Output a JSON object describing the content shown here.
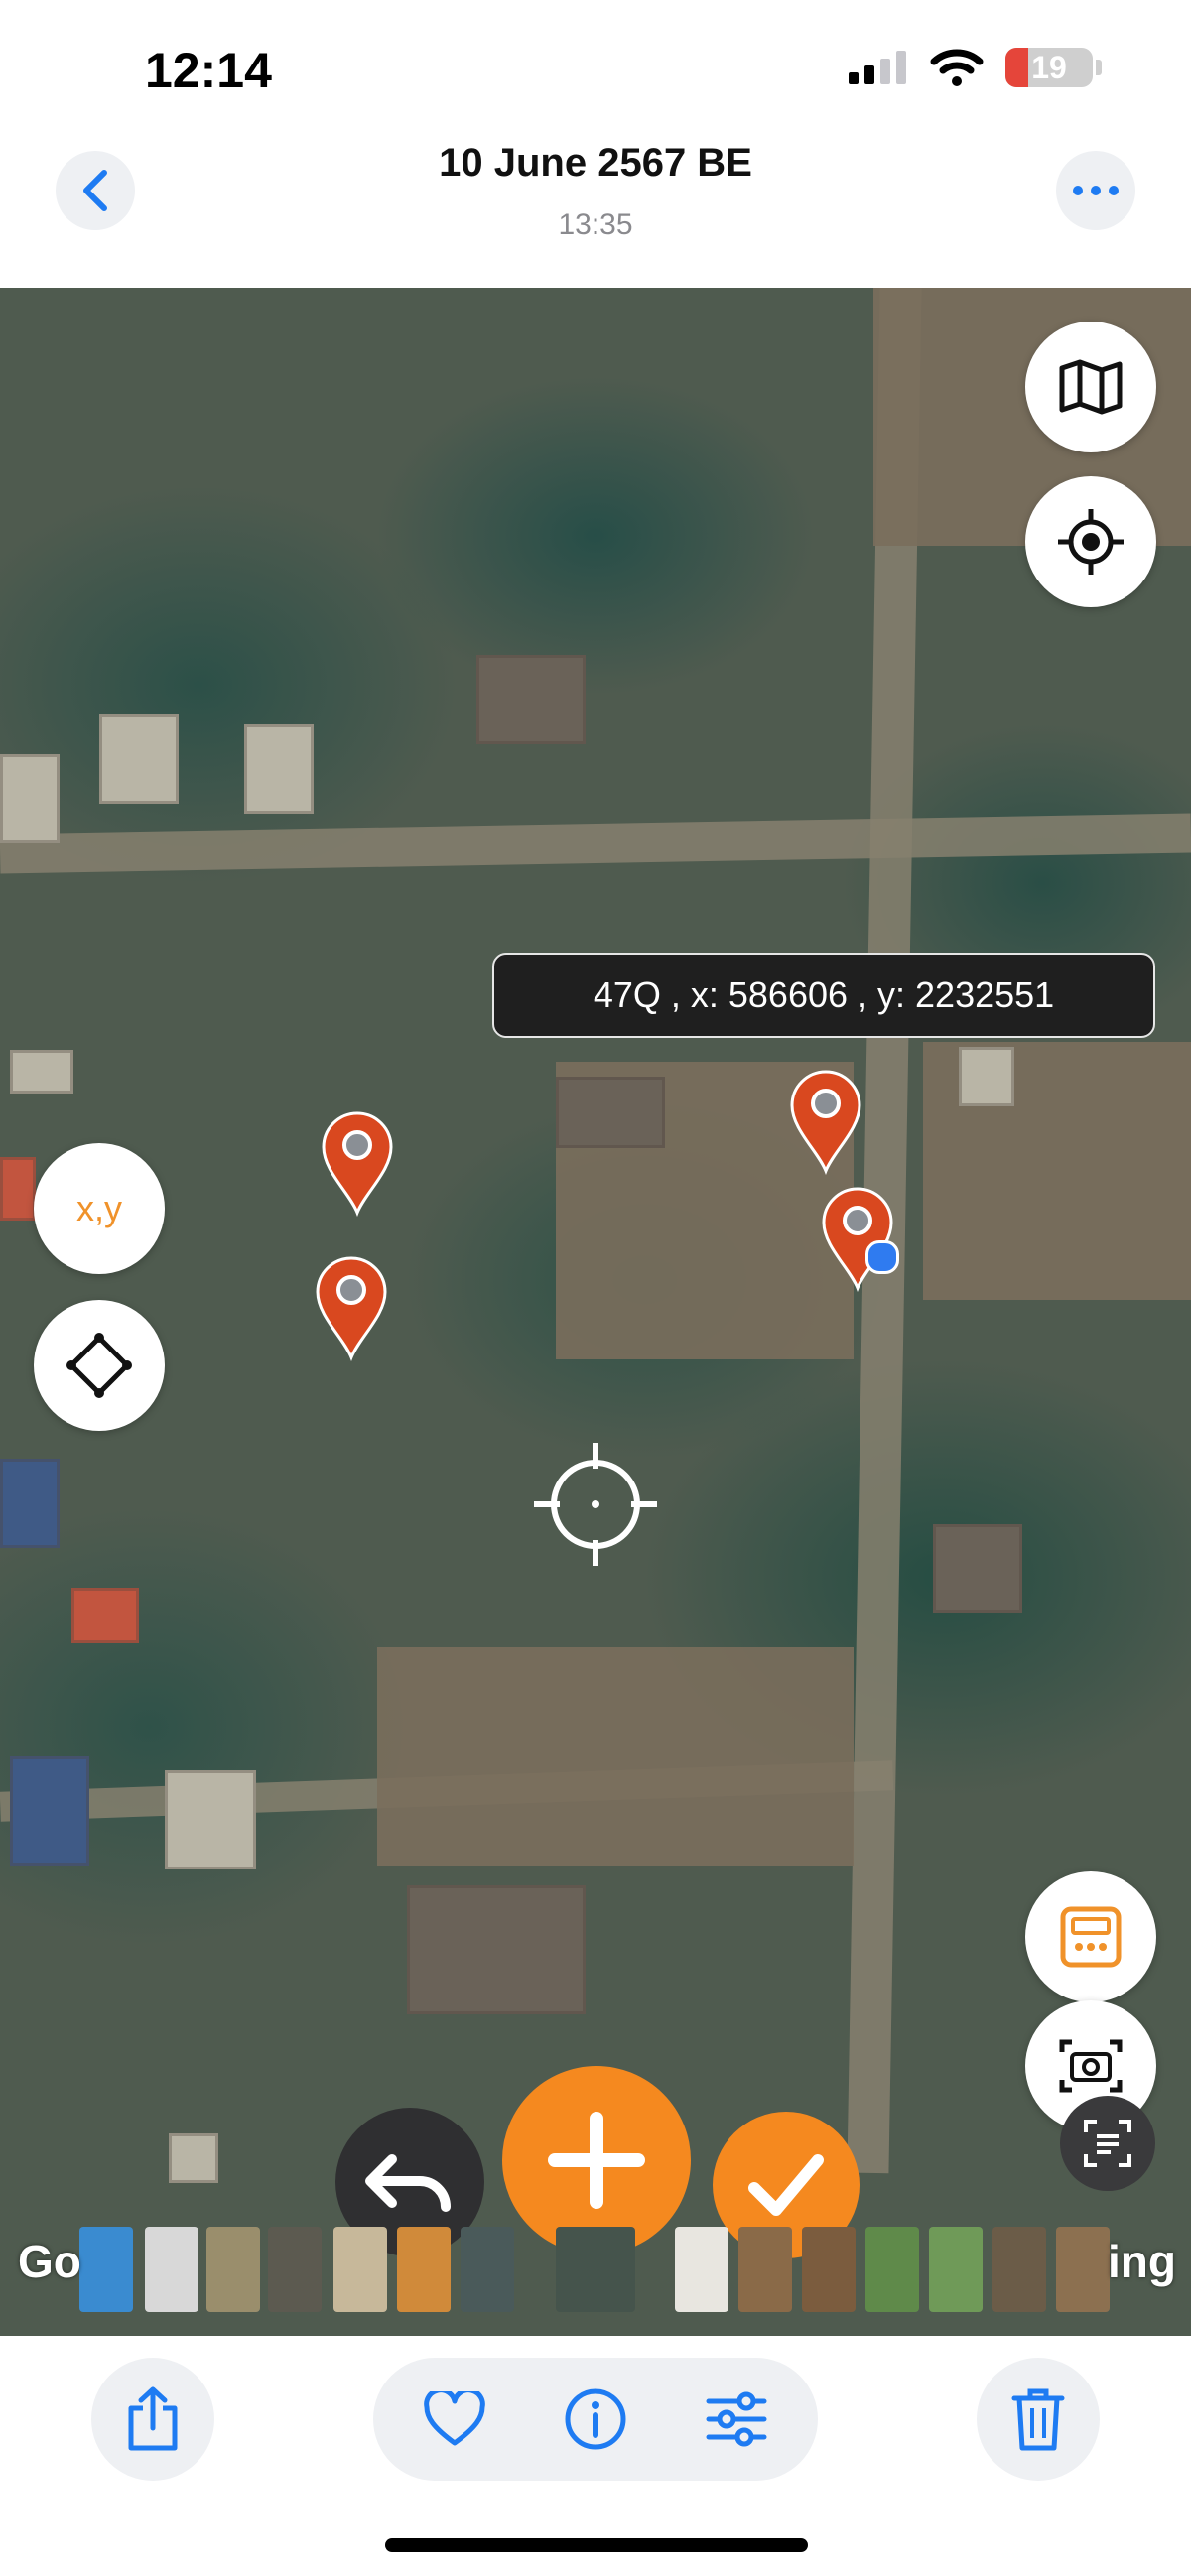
{
  "status_bar": {
    "time": "12:14",
    "battery": "19"
  },
  "nav": {
    "title": "10 June 2567 BE",
    "subtitle": "13:35"
  },
  "map": {
    "coordinate_readout": "47Q , x: 586606 , y: 2232551",
    "xy_button_label": "x,y",
    "attribution_left": "Go",
    "attribution_right": "ing"
  },
  "colors": {
    "accent_orange": "#f5891f",
    "pin_red": "#d9481f",
    "ios_blue": "#1e7bf2"
  },
  "icons": {
    "nav": [
      "back-chevron-icon",
      "more-icon"
    ],
    "map_controls": [
      "map-icon",
      "locate-icon",
      "xy-button",
      "polygon-icon",
      "calculator-icon",
      "camera-capture-icon",
      "text-scan-icon"
    ],
    "actions": [
      "undo-icon",
      "add-icon",
      "check-icon"
    ],
    "toolbar": [
      "share-icon",
      "heart-icon",
      "info-icon",
      "adjust-icon",
      "trash-icon"
    ]
  }
}
